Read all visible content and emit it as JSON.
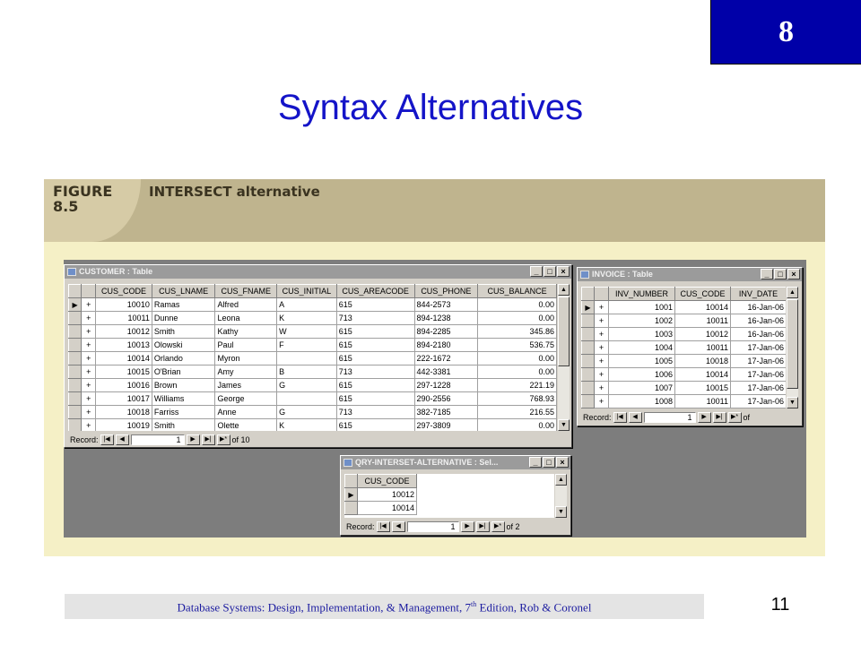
{
  "chapter_number": "8",
  "slide_title": "Syntax Alternatives",
  "figure": {
    "label_line1": "FIGURE",
    "label_line2": "8.5",
    "caption": "INTERSECT alternative"
  },
  "customer_table": {
    "title": "CUSTOMER : Table",
    "columns": [
      "CUS_CODE",
      "CUS_LNAME",
      "CUS_FNAME",
      "CUS_INITIAL",
      "CUS_AREACODE",
      "CUS_PHONE",
      "CUS_BALANCE"
    ],
    "rows": [
      [
        "10010",
        "Ramas",
        "Alfred",
        "A",
        "615",
        "844-2573",
        "0.00"
      ],
      [
        "10011",
        "Dunne",
        "Leona",
        "K",
        "713",
        "894-1238",
        "0.00"
      ],
      [
        "10012",
        "Smith",
        "Kathy",
        "W",
        "615",
        "894-2285",
        "345.86"
      ],
      [
        "10013",
        "Olowski",
        "Paul",
        "F",
        "615",
        "894-2180",
        "536.75"
      ],
      [
        "10014",
        "Orlando",
        "Myron",
        "",
        "615",
        "222-1672",
        "0.00"
      ],
      [
        "10015",
        "O'Brian",
        "Amy",
        "B",
        "713",
        "442-3381",
        "0.00"
      ],
      [
        "10016",
        "Brown",
        "James",
        "G",
        "615",
        "297-1228",
        "221.19"
      ],
      [
        "10017",
        "Williams",
        "George",
        "",
        "615",
        "290-2556",
        "768.93"
      ],
      [
        "10018",
        "Farriss",
        "Anne",
        "G",
        "713",
        "382-7185",
        "216.55"
      ],
      [
        "10019",
        "Smith",
        "Olette",
        "K",
        "615",
        "297-3809",
        "0.00"
      ]
    ],
    "record_label": "Record:",
    "record_current": "1",
    "record_of": "of 10"
  },
  "invoice_table": {
    "title": "INVOICE : Table",
    "columns": [
      "INV_NUMBER",
      "CUS_CODE",
      "INV_DATE"
    ],
    "rows": [
      [
        "1001",
        "10014",
        "16-Jan-06"
      ],
      [
        "1002",
        "10011",
        "16-Jan-06"
      ],
      [
        "1003",
        "10012",
        "16-Jan-06"
      ],
      [
        "1004",
        "10011",
        "17-Jan-06"
      ],
      [
        "1005",
        "10018",
        "17-Jan-06"
      ],
      [
        "1006",
        "10014",
        "17-Jan-06"
      ],
      [
        "1007",
        "10015",
        "17-Jan-06"
      ],
      [
        "1008",
        "10011",
        "17-Jan-06"
      ]
    ],
    "record_label": "Record:",
    "record_current": "1",
    "record_of": "of"
  },
  "query_table": {
    "title": "QRY-INTERSET-ALTERNATIVE : Sel...",
    "columns": [
      "CUS_CODE"
    ],
    "rows": [
      [
        "10012"
      ],
      [
        "10014"
      ]
    ],
    "record_label": "Record:",
    "record_current": "1",
    "record_of": "of 2"
  },
  "footer": {
    "text_prefix": "Database Systems: Design, Implementation, & Management, 7",
    "text_sup": "th",
    "text_suffix": " Edition, Rob & Coronel"
  },
  "page_number": "11",
  "colors": {
    "chapter_box": "#0000a8",
    "title": "#1414c8",
    "figure_bg": "#f5f0c6",
    "figure_header": "#bfb48e",
    "workspace": "#7d7d7d",
    "window_chrome": "#d4d0c8"
  },
  "icons": {
    "minimize": "minimize-icon",
    "maximize": "maximize-icon",
    "close": "close-icon",
    "record_selector": "record-selector-triangle-icon",
    "expand": "plus-expand-icon"
  }
}
